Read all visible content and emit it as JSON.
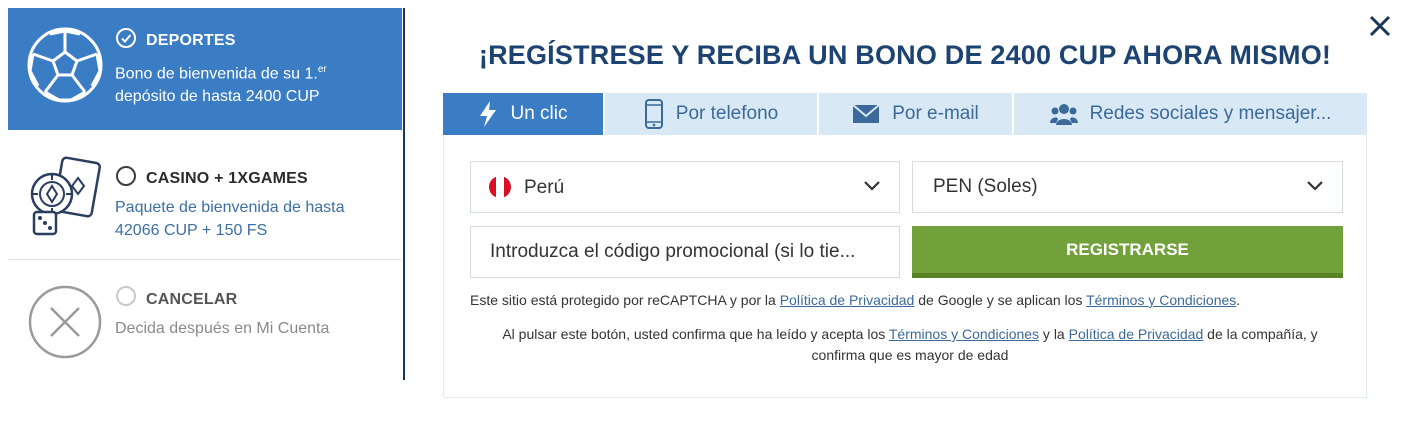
{
  "bonuses": [
    {
      "title": "DEPORTES",
      "desc_line1": "Bono de bienvenida de su 1.",
      "desc_sup": "er",
      "desc_line2": "depósito de hasta 2400 CUP",
      "icon": "soccer-ball-icon",
      "selected": true
    },
    {
      "title": "CASINO + 1XGAMES",
      "desc_line1": "Paquete de bienvenida de hasta",
      "desc_line2": "42066 CUP + 150 FS",
      "icon": "casino-chip-cards-icon",
      "selected": false
    },
    {
      "title": "CANCELAR",
      "desc": "Decida después en Mi Cuenta",
      "icon": "cancel-circle-icon",
      "selected": false
    }
  ],
  "headline": "¡REGÍSTRESE Y RECIBA UN BONO DE 2400 CUP AHORA MISMO!",
  "tabs": [
    {
      "label": "Un clic",
      "icon": "lightning-icon",
      "active": true
    },
    {
      "label": "Por telefono",
      "icon": "phone-icon",
      "active": false
    },
    {
      "label": "Por e-mail",
      "icon": "envelope-icon",
      "active": false
    },
    {
      "label": "Redes sociales y mensajer...",
      "icon": "users-icon",
      "active": false
    }
  ],
  "form": {
    "country": "Perú",
    "currency": "PEN (Soles)",
    "promo_placeholder": "Introduzca el código promocional (si lo tie...",
    "register_label": "REGISTRARSE"
  },
  "legal": {
    "recaptcha_pre": "Este sitio está protegido por reCAPTCHA y por la ",
    "privacy_link": "Política de Privacidad",
    "recaptcha_mid": " de Google y se aplican los ",
    "terms_link": "Términos y Condiciones",
    "recaptcha_end": ".",
    "confirm_pre": "Al pulsar este botón, usted confirma que ha leído y acepta los ",
    "confirm_mid": " y la ",
    "confirm_end": " de la compañía, y",
    "confirm_line2": "confirma que es mayor de edad"
  },
  "colors": {
    "accent_blue": "#3b7dc4",
    "headline_navy": "#1d4372",
    "tab_inactive_bg": "#d9e8f5",
    "register_green": "#72a03a"
  }
}
